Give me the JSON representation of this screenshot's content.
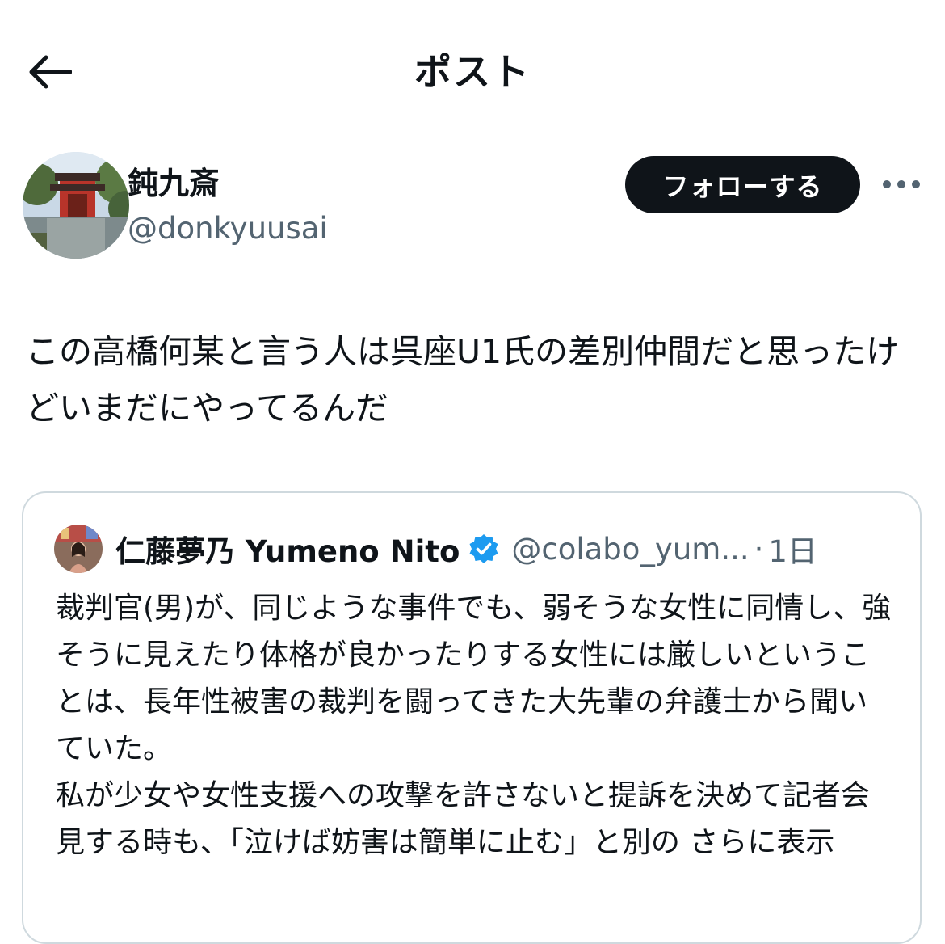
{
  "header": {
    "title": "ポスト",
    "back_icon": "arrow-left-icon"
  },
  "author": {
    "display_name": "鈍九斎",
    "handle": "@donkyuusai",
    "follow_label": "フォローする",
    "more_icon": "ellipsis-icon"
  },
  "post": {
    "text": "この高橋何某と言う人は呉座U1氏の差別仲間だと思ったけどいまだにやってるんだ"
  },
  "quote": {
    "name": "仁藤夢乃  Yumeno Nito",
    "verified_icon": "verified-badge-icon",
    "verified_color": "#1d9bf0",
    "handle": "@colabo_yum...",
    "separator": "·",
    "time": "1日",
    "text": "裁判官(男)が、同じような事件でも、弱そうな女性に同情し、強そうに見えたり体格が良かったりする女性には厳しいということは、長年性被害の裁判を闘ってきた大先輩の弁護士から聞いていた。\n私が少女や女性支援への攻撃を許さないと提訴を決めて記者会見する時も、「泣けば妨害は簡単に止む」と別の",
    "show_more": "さらに表示"
  },
  "colors": {
    "text": "#0f1419",
    "secondary": "#536471",
    "border": "#cfd9de",
    "button_bg": "#0f1419"
  }
}
